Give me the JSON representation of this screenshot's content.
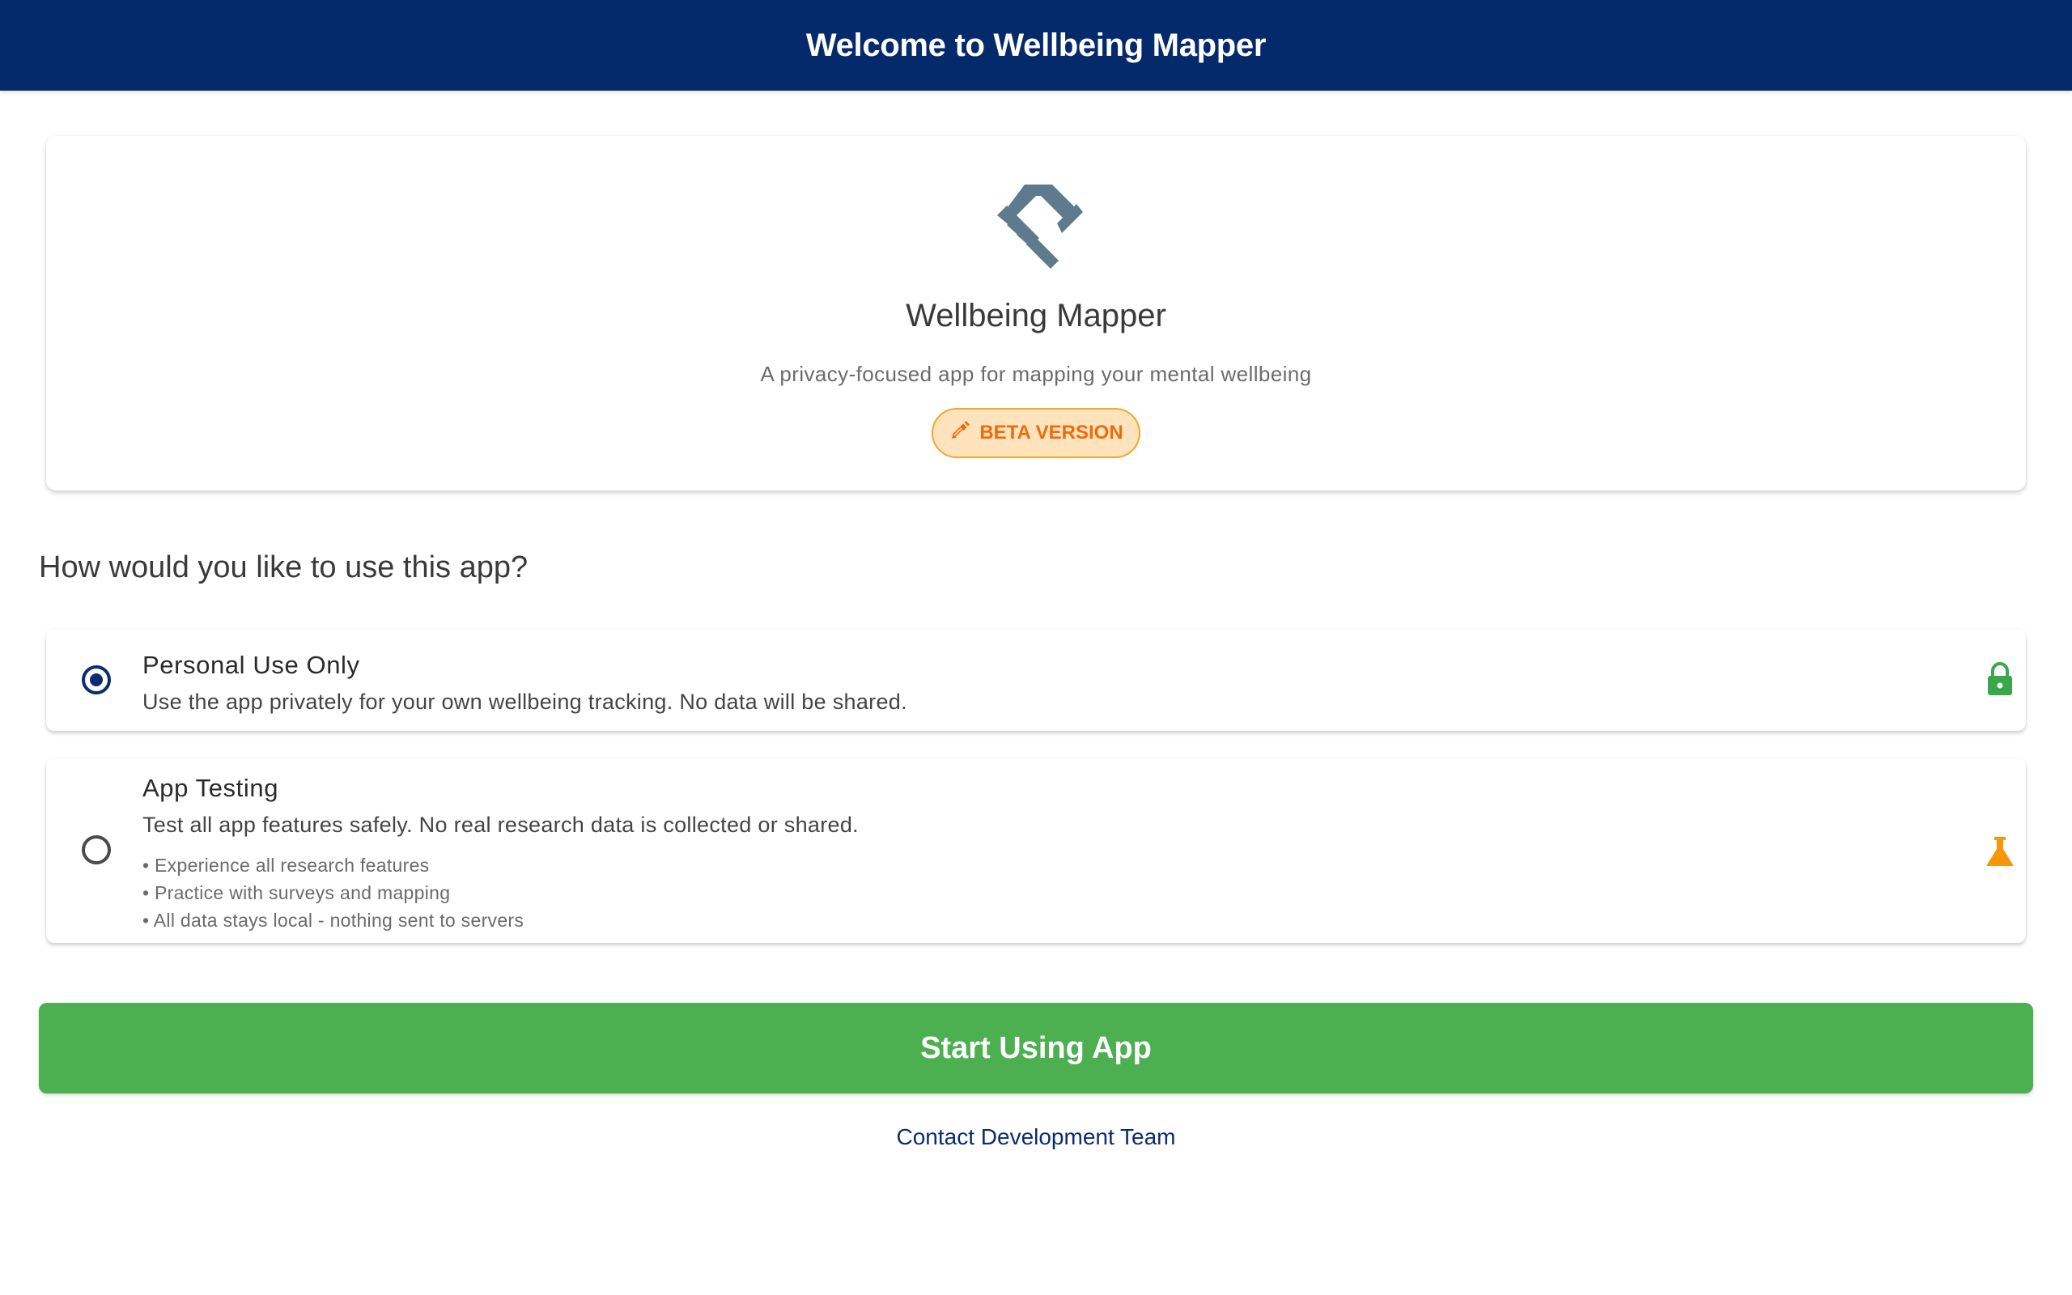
{
  "appbar": {
    "title": "Welcome to Wellbeing Mapper",
    "background_color": "#042a6b"
  },
  "hero": {
    "icon": "handshake-icon",
    "icon_color": "#5e7a8e",
    "app_name": "Wellbeing Mapper",
    "subtitle": "A privacy-focused app for mapping your mental wellbeing",
    "badge": {
      "icon": "pencil-icon",
      "label": "BETA VERSION",
      "text_color": "#ee6b0b",
      "background_color": "#ffe3bd"
    }
  },
  "question": "How would you like to use this app?",
  "options": [
    {
      "id": "personal",
      "title": "Personal Use Only",
      "description": "Use the app privately for your own wellbeing tracking. No data will be shared.",
      "selected": true,
      "icon": "lock-icon",
      "icon_color": "#3aa84a"
    },
    {
      "id": "testing",
      "title": "App Testing",
      "description": "Test all app features safely. No real research data is collected or shared.",
      "selected": false,
      "icon": "flask-icon",
      "icon_color": "#f7960a",
      "bullets": [
        "• Experience all research features",
        "• Practice with surveys and mapping",
        "• All data stays local - nothing sent to servers"
      ]
    }
  ],
  "actions": {
    "start_label": "Start Using App",
    "start_color": "#4caf50",
    "contact_label": "Contact Development Team",
    "contact_color": "#0b2c6e"
  }
}
